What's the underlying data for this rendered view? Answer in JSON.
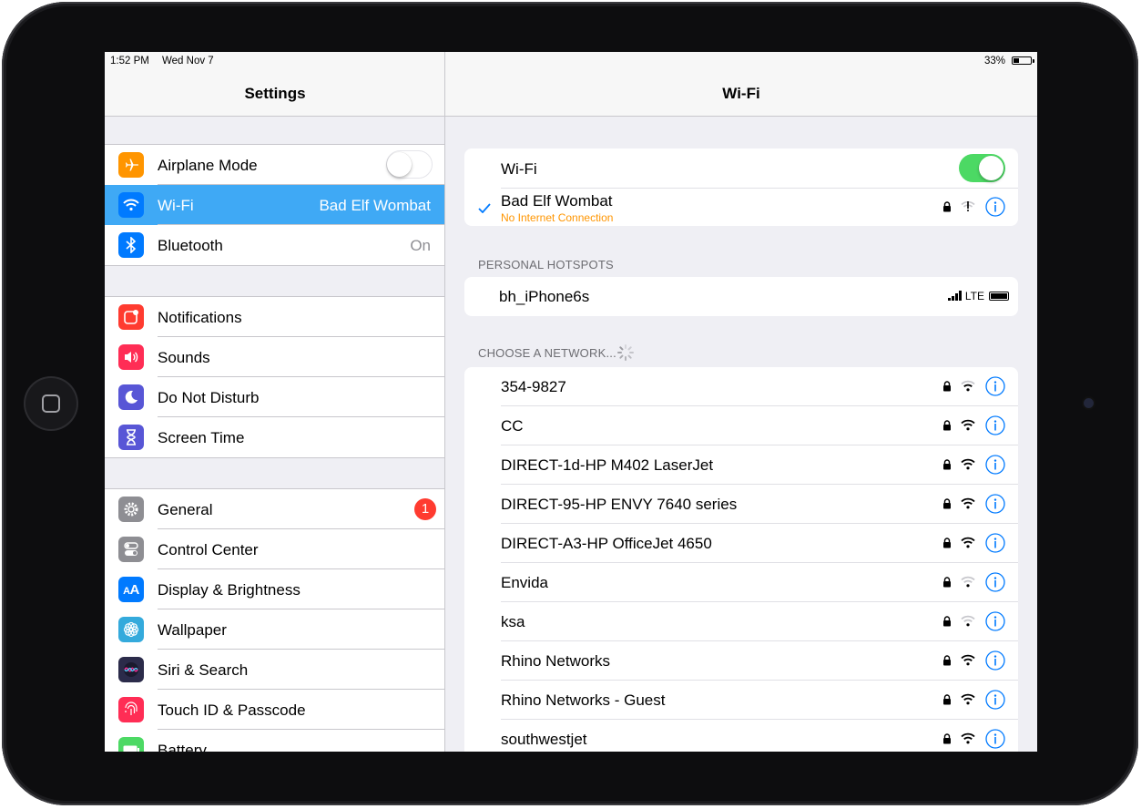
{
  "status_bar": {
    "time": "1:52 PM",
    "date": "Wed Nov 7",
    "battery_percent": "33%",
    "battery_level": 0.33
  },
  "master": {
    "title": "Settings",
    "groups": [
      [
        {
          "label": "Airplane Mode",
          "icon": "airplane-icon",
          "color": "#ff9500",
          "toggle": "off"
        },
        {
          "label": "Wi-Fi",
          "value": "Bad Elf Wombat",
          "icon": "wifi-icon",
          "color": "#007aff",
          "selected": true
        },
        {
          "label": "Bluetooth",
          "value": "On",
          "icon": "bluetooth-icon",
          "color": "#007aff"
        }
      ],
      [
        {
          "label": "Notifications",
          "icon": "notifications-icon",
          "color": "#ff3b30"
        },
        {
          "label": "Sounds",
          "icon": "speaker-icon",
          "color": "#ff2d55"
        },
        {
          "label": "Do Not Disturb",
          "icon": "moon-icon",
          "color": "#5856d6"
        },
        {
          "label": "Screen Time",
          "icon": "hourglass-icon",
          "color": "#5856d6"
        }
      ],
      [
        {
          "label": "General",
          "icon": "gear-icon",
          "color": "#8e8e93",
          "badge": "1"
        },
        {
          "label": "Control Center",
          "icon": "switches-icon",
          "color": "#8e8e93"
        },
        {
          "label": "Display & Brightness",
          "icon": "text-size-icon",
          "color": "#007aff"
        },
        {
          "label": "Wallpaper",
          "icon": "flower-icon",
          "color": "#34aadc"
        },
        {
          "label": "Siri & Search",
          "icon": "siri-icon",
          "color": "#2b2b4a"
        },
        {
          "label": "Touch ID & Passcode",
          "icon": "fingerprint-icon",
          "color": "#ff2d55"
        },
        {
          "label": "Battery",
          "icon": "battery-icon",
          "color": "#4cd964"
        }
      ]
    ]
  },
  "detail": {
    "title": "Wi-Fi",
    "wifi_label": "Wi-Fi",
    "wifi_toggle": "on",
    "connected": {
      "name": "Bad Elf Wombat",
      "subtitle": "No Internet Connection",
      "subtitle_color": "#ff9500"
    },
    "hotspots_header": "PERSONAL HOTSPOTS",
    "hotspot": {
      "name": "bh_iPhone6s",
      "network": "LTE"
    },
    "choose_header": "CHOOSE A NETWORK...",
    "networks": [
      {
        "name": "354-9827",
        "signal": 2
      },
      {
        "name": "CC",
        "signal": 3
      },
      {
        "name": "DIRECT-1d-HP M402 LaserJet",
        "signal": 3
      },
      {
        "name": "DIRECT-95-HP ENVY 7640 series",
        "signal": 3
      },
      {
        "name": "DIRECT-A3-HP OfficeJet 4650",
        "signal": 3
      },
      {
        "name": "Envida",
        "signal": 1
      },
      {
        "name": "ksa",
        "signal": 1
      },
      {
        "name": "Rhino Networks",
        "signal": 3
      },
      {
        "name": "Rhino Networks - Guest",
        "signal": 3
      },
      {
        "name": "southwestjet",
        "signal": 3
      }
    ],
    "accent_color": "#007aff"
  }
}
